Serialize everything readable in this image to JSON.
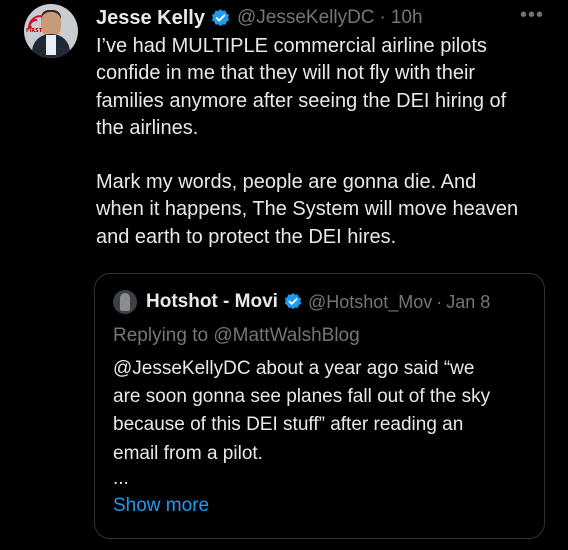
{
  "tweet": {
    "author_name": "Jesse Kelly",
    "handle": "@JesseKellyDC",
    "separator": "·",
    "time": "10h",
    "more_label": "•••",
    "avatar_logo_text": "FIRST",
    "paragraphs": [
      "I’ve had MULTIPLE commercial airline pilots\nconfide in me that they will not fly with their\nfamilies anymore after seeing the DEI hiring of\nthe airlines.",
      "Mark my words, people are gonna die. And\nwhen it happens, The System will move heaven\nand earth to protect the DEI hires."
    ]
  },
  "quote": {
    "author_name": "Hotshot - Movi",
    "handle": "@Hotshot_Mov",
    "separator": "·",
    "time": "Jan 8",
    "replying_to": "Replying to @MattWalshBlog",
    "text": "@JesseKellyDC about a year ago said “we\nare soon gonna see planes fall out of the sky\nbecause of this DEI stuff” after reading an\nemail from a pilot.",
    "ellipsis": "...",
    "show_more": "Show more"
  },
  "colors": {
    "background": "#000000",
    "text_primary": "#e7e9ea",
    "text_secondary": "#71767b",
    "accent": "#1d9bf0",
    "border": "#2f3336"
  }
}
